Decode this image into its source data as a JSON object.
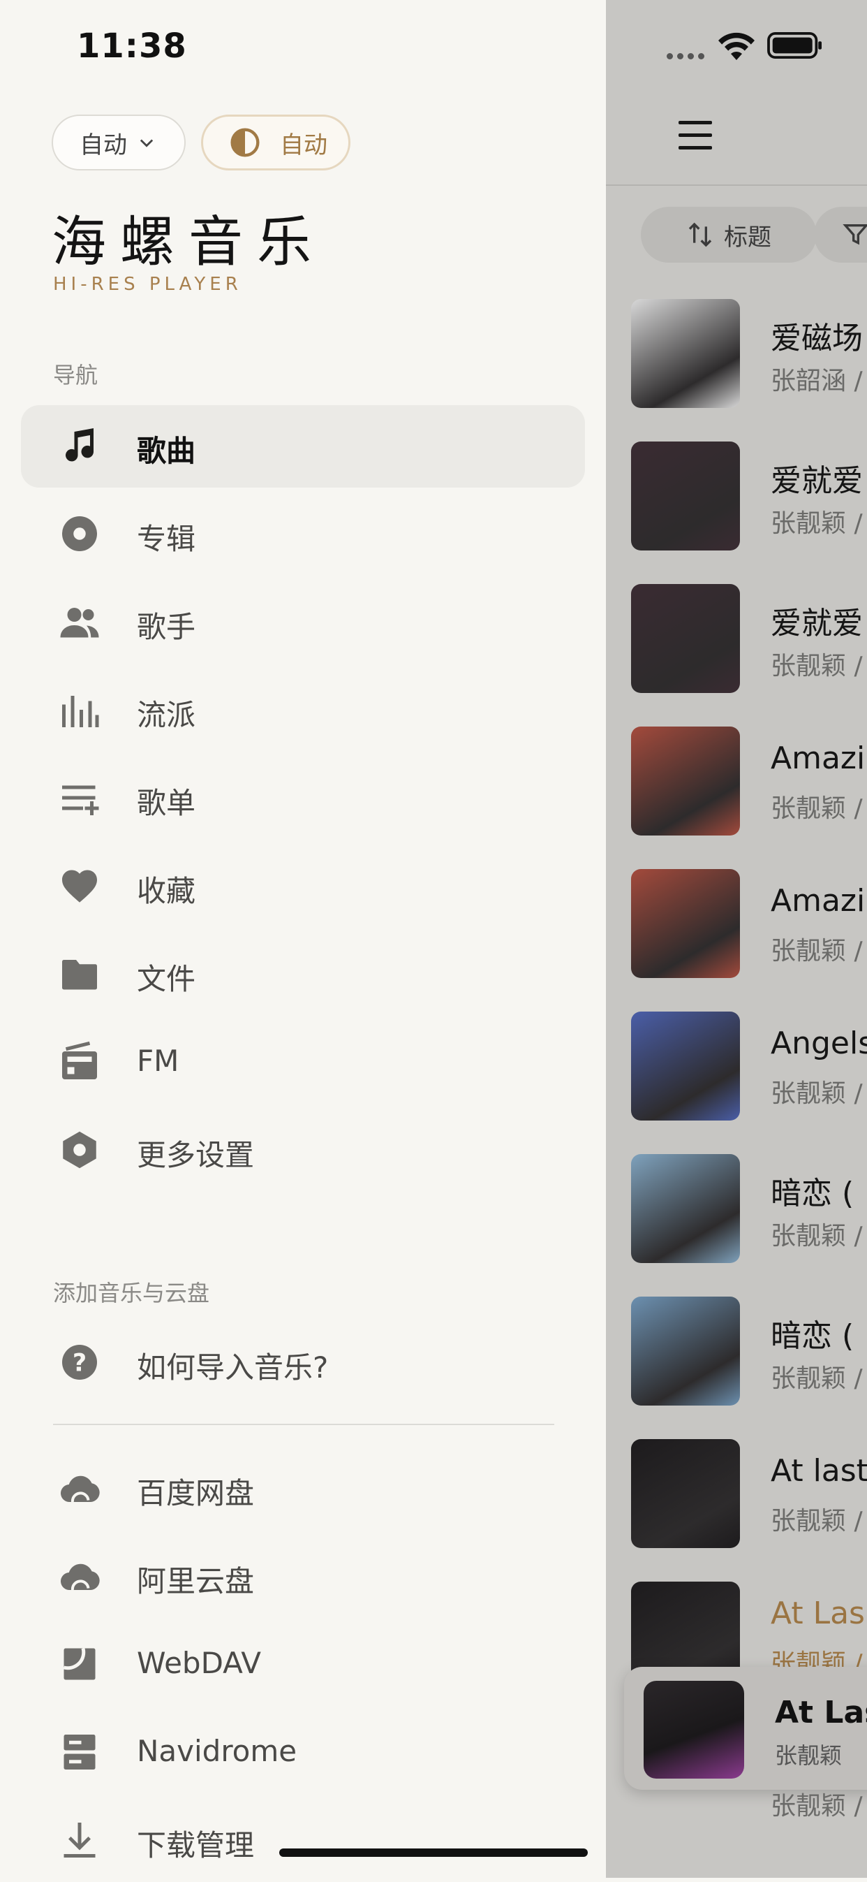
{
  "status": {
    "time": "11:38"
  },
  "drawer": {
    "lang_pill": "自动",
    "theme_pill": "自动",
    "app_title": "海螺音乐",
    "app_subtitle": "HI-RES PLAYER",
    "nav_section": "导航",
    "nav_items": [
      {
        "label": "歌曲",
        "icon": "music-note-icon",
        "active": true
      },
      {
        "label": "专辑",
        "icon": "disc-icon"
      },
      {
        "label": "歌手",
        "icon": "people-icon"
      },
      {
        "label": "流派",
        "icon": "equalizer-icon"
      },
      {
        "label": "歌单",
        "icon": "playlist-add-icon"
      },
      {
        "label": "收藏",
        "icon": "heart-icon"
      },
      {
        "label": "文件",
        "icon": "folder-icon"
      },
      {
        "label": "FM",
        "icon": "radio-icon"
      },
      {
        "label": "更多设置",
        "icon": "settings-hexagon-icon"
      }
    ],
    "add_section": "添加音乐与云盘",
    "help_item": "如何导入音乐?",
    "cloud_items": [
      {
        "label": "百度网盘",
        "icon": "cloud-icon"
      },
      {
        "label": "阿里云盘",
        "icon": "cloud-icon"
      },
      {
        "label": "WebDAV",
        "icon": "webdav-icon"
      },
      {
        "label": "Navidrome",
        "icon": "server-icon"
      },
      {
        "label": "下载管理",
        "icon": "download-icon"
      }
    ]
  },
  "list": {
    "sort_label": "标题",
    "songs": [
      {
        "title": "爱磁场",
        "sub": "张韶涵 /"
      },
      {
        "title": "爱就爱",
        "sub": "张靓颖 /"
      },
      {
        "title": "爱就爱",
        "sub": "张靓颖 /"
      },
      {
        "title": "Amazi",
        "sub": "张靓颖 /"
      },
      {
        "title": "Amazi",
        "sub": "张靓颖 /"
      },
      {
        "title": "Angels",
        "sub": "张靓颖 /"
      },
      {
        "title": "暗恋 (",
        "sub": "张靓颖 /"
      },
      {
        "title": "暗恋 (",
        "sub": "张靓颖 /"
      },
      {
        "title": "At last",
        "sub": "张靓颖 /"
      },
      {
        "title": "At Las",
        "sub": "张靓颖 /",
        "playing": true
      }
    ],
    "cover_colors": [
      "#d8d8d8",
      "#3a2b32",
      "#3a2b32",
      "#a34a3c",
      "#a34a3c",
      "#4a5ea8",
      "#7fa2bd",
      "#6c90b0",
      "#1d1b1d",
      "#1d1b1d"
    ],
    "mini_player": {
      "title": "At Last",
      "artist": "张靓颖"
    },
    "partial_row_sub": "张靓颖 /"
  },
  "colors": {
    "accent": "#a8804e",
    "drawer_bg": "#f7f6f2",
    "active_row": "#ebeae6"
  }
}
